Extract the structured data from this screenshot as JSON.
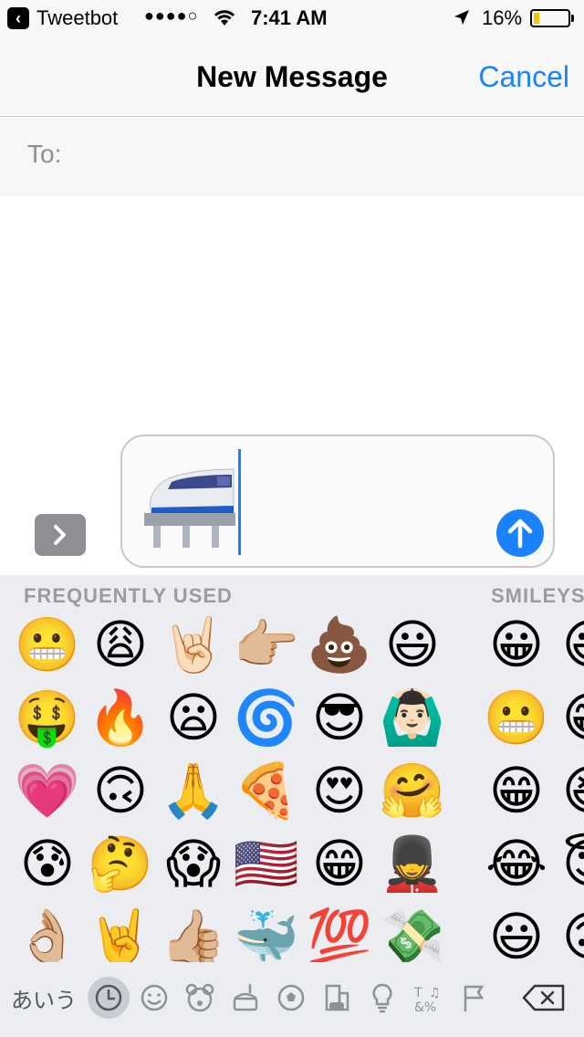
{
  "status_bar": {
    "back_app": "Tweetbot",
    "signal": "●●●●○",
    "time": "7:41 AM",
    "battery_percent": "16%",
    "battery_level": 0.16,
    "battery_color": "#f5c400",
    "icons": [
      "back-icon",
      "wifi-icon",
      "location-arrow-icon",
      "battery-icon"
    ]
  },
  "nav": {
    "title": "New Message",
    "cancel_label": "Cancel",
    "accent": "#1a82fb"
  },
  "to_row": {
    "label": "To:",
    "value": ""
  },
  "compose": {
    "content_emoji": "🚝",
    "send_icon": "arrow-up-icon",
    "expand_icon": "chevron-right-icon"
  },
  "keyboard": {
    "section_frequent": "FREQUENTLY USED",
    "section_smileys": "SMILEYS",
    "frequent": [
      "😬",
      "😩",
      "🤘🏻",
      "👉🏼",
      "💩",
      "😃",
      "🤑",
      "🔥",
      "😦",
      "🌀",
      "😎",
      "🙆🏻‍♂️",
      "💗",
      "🙃",
      "🙏",
      "🍕",
      "😍",
      "🤗",
      "😰",
      "🤔",
      "😱",
      "🇺🇸",
      "😁",
      "💂",
      "👌🏼",
      "🤘",
      "👍🏼",
      "🐳",
      "💯",
      "💸"
    ],
    "smileys": [
      "😀",
      "😃",
      "😬",
      "😁",
      "😁",
      "😆",
      "😂",
      "😇",
      "😃",
      "🙃"
    ],
    "bottom": {
      "abc_label": "あいう",
      "categories": [
        "clock-icon",
        "smiley-icon",
        "bear-icon",
        "food-icon",
        "ball-icon",
        "building-icon",
        "bulb-icon",
        "symbols-icon",
        "flag-icon"
      ],
      "active_category": "clock-icon",
      "delete_icon": "delete-icon"
    }
  }
}
